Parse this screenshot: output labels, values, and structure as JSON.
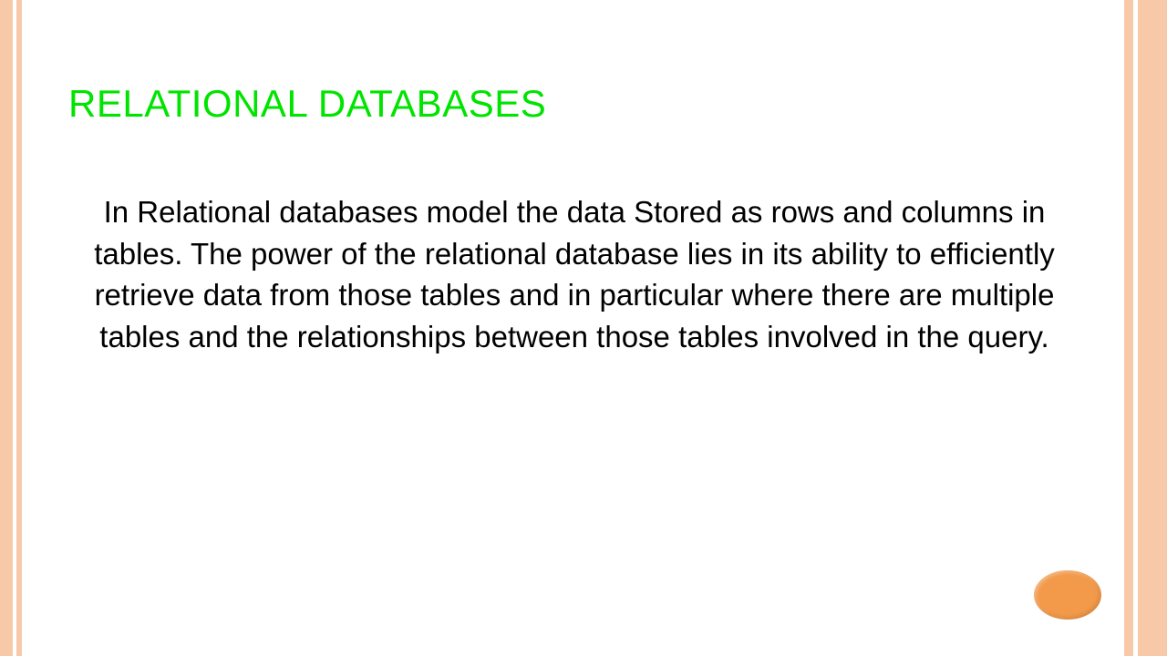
{
  "slide": {
    "title": "RELATIONAL DATABASES",
    "body": "In Relational databases model  the data Stored as rows and columns in tables.  The power of the relational database lies in its ability to efficiently retrieve data from those tables and in particular where there are multiple tables and the relationships between those tables involved in the query."
  }
}
